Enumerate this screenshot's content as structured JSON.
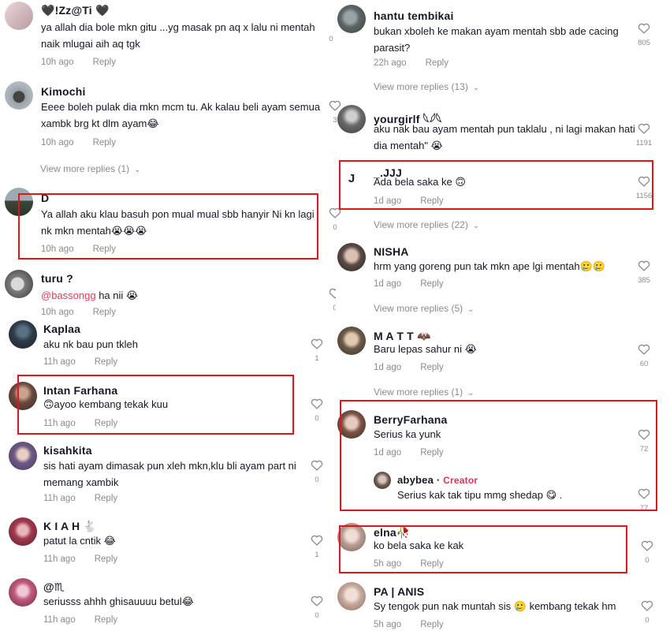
{
  "left": [
    {
      "user": "🖤!Zz@Ti 🖤",
      "text": "ya allah dia bole mkn gitu ...yg masak pn aq x lalu ni mentah naik mlugai aih aq tgk",
      "time": "10h ago",
      "reply": "Reply",
      "likes": "0"
    },
    {
      "user": "Kimochi",
      "text": "Eeee boleh pulak dia mkn mcm tu. Ak kalau beli ayam semua xambk brg kt dlm ayam😂",
      "time": "10h ago",
      "reply": "Reply",
      "likes": "3",
      "more": "View more replies (1)"
    },
    {
      "user": "D",
      "text": "Ya allah aku klau basuh pon mual mual sbb hanyir Ni kn lagi nk mkn mentah😭😭😭",
      "time": "10h ago",
      "reply": "Reply",
      "likes": "0"
    },
    {
      "user": "turu ?",
      "mention": "@bassongg",
      "text": " ha nii 😭",
      "time": "10h ago",
      "reply": "Reply",
      "likes": "0"
    },
    {
      "user": "Kaplaa",
      "text": "aku nk bau pun tkleh",
      "time": "11h ago",
      "reply": "Reply",
      "likes": "1"
    },
    {
      "user": "Intan Farhana",
      "text": "🙃ayoo kembang tekak kuu",
      "time": "11h ago",
      "reply": "Reply",
      "likes": "0"
    },
    {
      "user": "kisahkita",
      "text": "sis hati ayam dimasak pun xleh mkn,klu bli ayam part ni memang xambik",
      "time": "11h ago",
      "reply": "Reply",
      "likes": "0"
    },
    {
      "user": "K I A H 🐇",
      "text": "patut la cntik 😂",
      "time": "11h ago",
      "reply": "Reply",
      "likes": "1"
    },
    {
      "user": "@♏",
      "text": "seriusss ahhh ghisauuuu betul😂",
      "time": "11h ago",
      "reply": "Reply",
      "likes": "0"
    }
  ],
  "right": [
    {
      "user": "hantu tembikai",
      "text": "bukan xboleh ke makan ayam mentah sbb ade cacing parasit?",
      "time": "22h ago",
      "reply": "Reply",
      "likes": "805",
      "more": "View more replies (13)"
    },
    {
      "user": "yourgirlf 𓆩𓆪𓆩",
      "text": "aku nak bau ayam mentah pun taklalu , ni lagi makan hati dia mentah\" 😭",
      "time": "",
      "reply": "",
      "likes": "1191"
    },
    {
      "user": "_.JJJ",
      "text": "Ada bela saka ke 🙃",
      "time": "1d ago",
      "reply": "Reply",
      "likes": "1156",
      "more": "View more replies (22)"
    },
    {
      "user": "NISHA",
      "text": "hrm yang goreng pun tak mkn ape lgi mentah🥲🥲",
      "time": "1d ago",
      "reply": "Reply",
      "likes": "385",
      "more": "View more replies (5)"
    },
    {
      "user": "M A T T 🦇",
      "text": "Baru lepas sahur ni 😭",
      "time": "1d ago",
      "reply": "Reply",
      "likes": "60",
      "more": "View more replies (1)"
    },
    {
      "user": "BerryFarhana",
      "text": "Serius ka yunk",
      "time": "1d ago",
      "reply": "Reply",
      "likes": "72"
    },
    {
      "user": "abybea",
      "badge": "Creator",
      "text": "Serius kak tak tipu mmg shedap 😋 .",
      "likes": "77"
    },
    {
      "user": "elna🥀",
      "text": "ko bela saka ke kak",
      "time": "5h ago",
      "reply": "Reply",
      "likes": "0"
    },
    {
      "user": "PA | ANIS",
      "text": "Sy tengok pun nak muntah sis 🥲 kembang tekak hm",
      "time": "5h ago",
      "reply": "Reply",
      "likes": "0"
    }
  ]
}
